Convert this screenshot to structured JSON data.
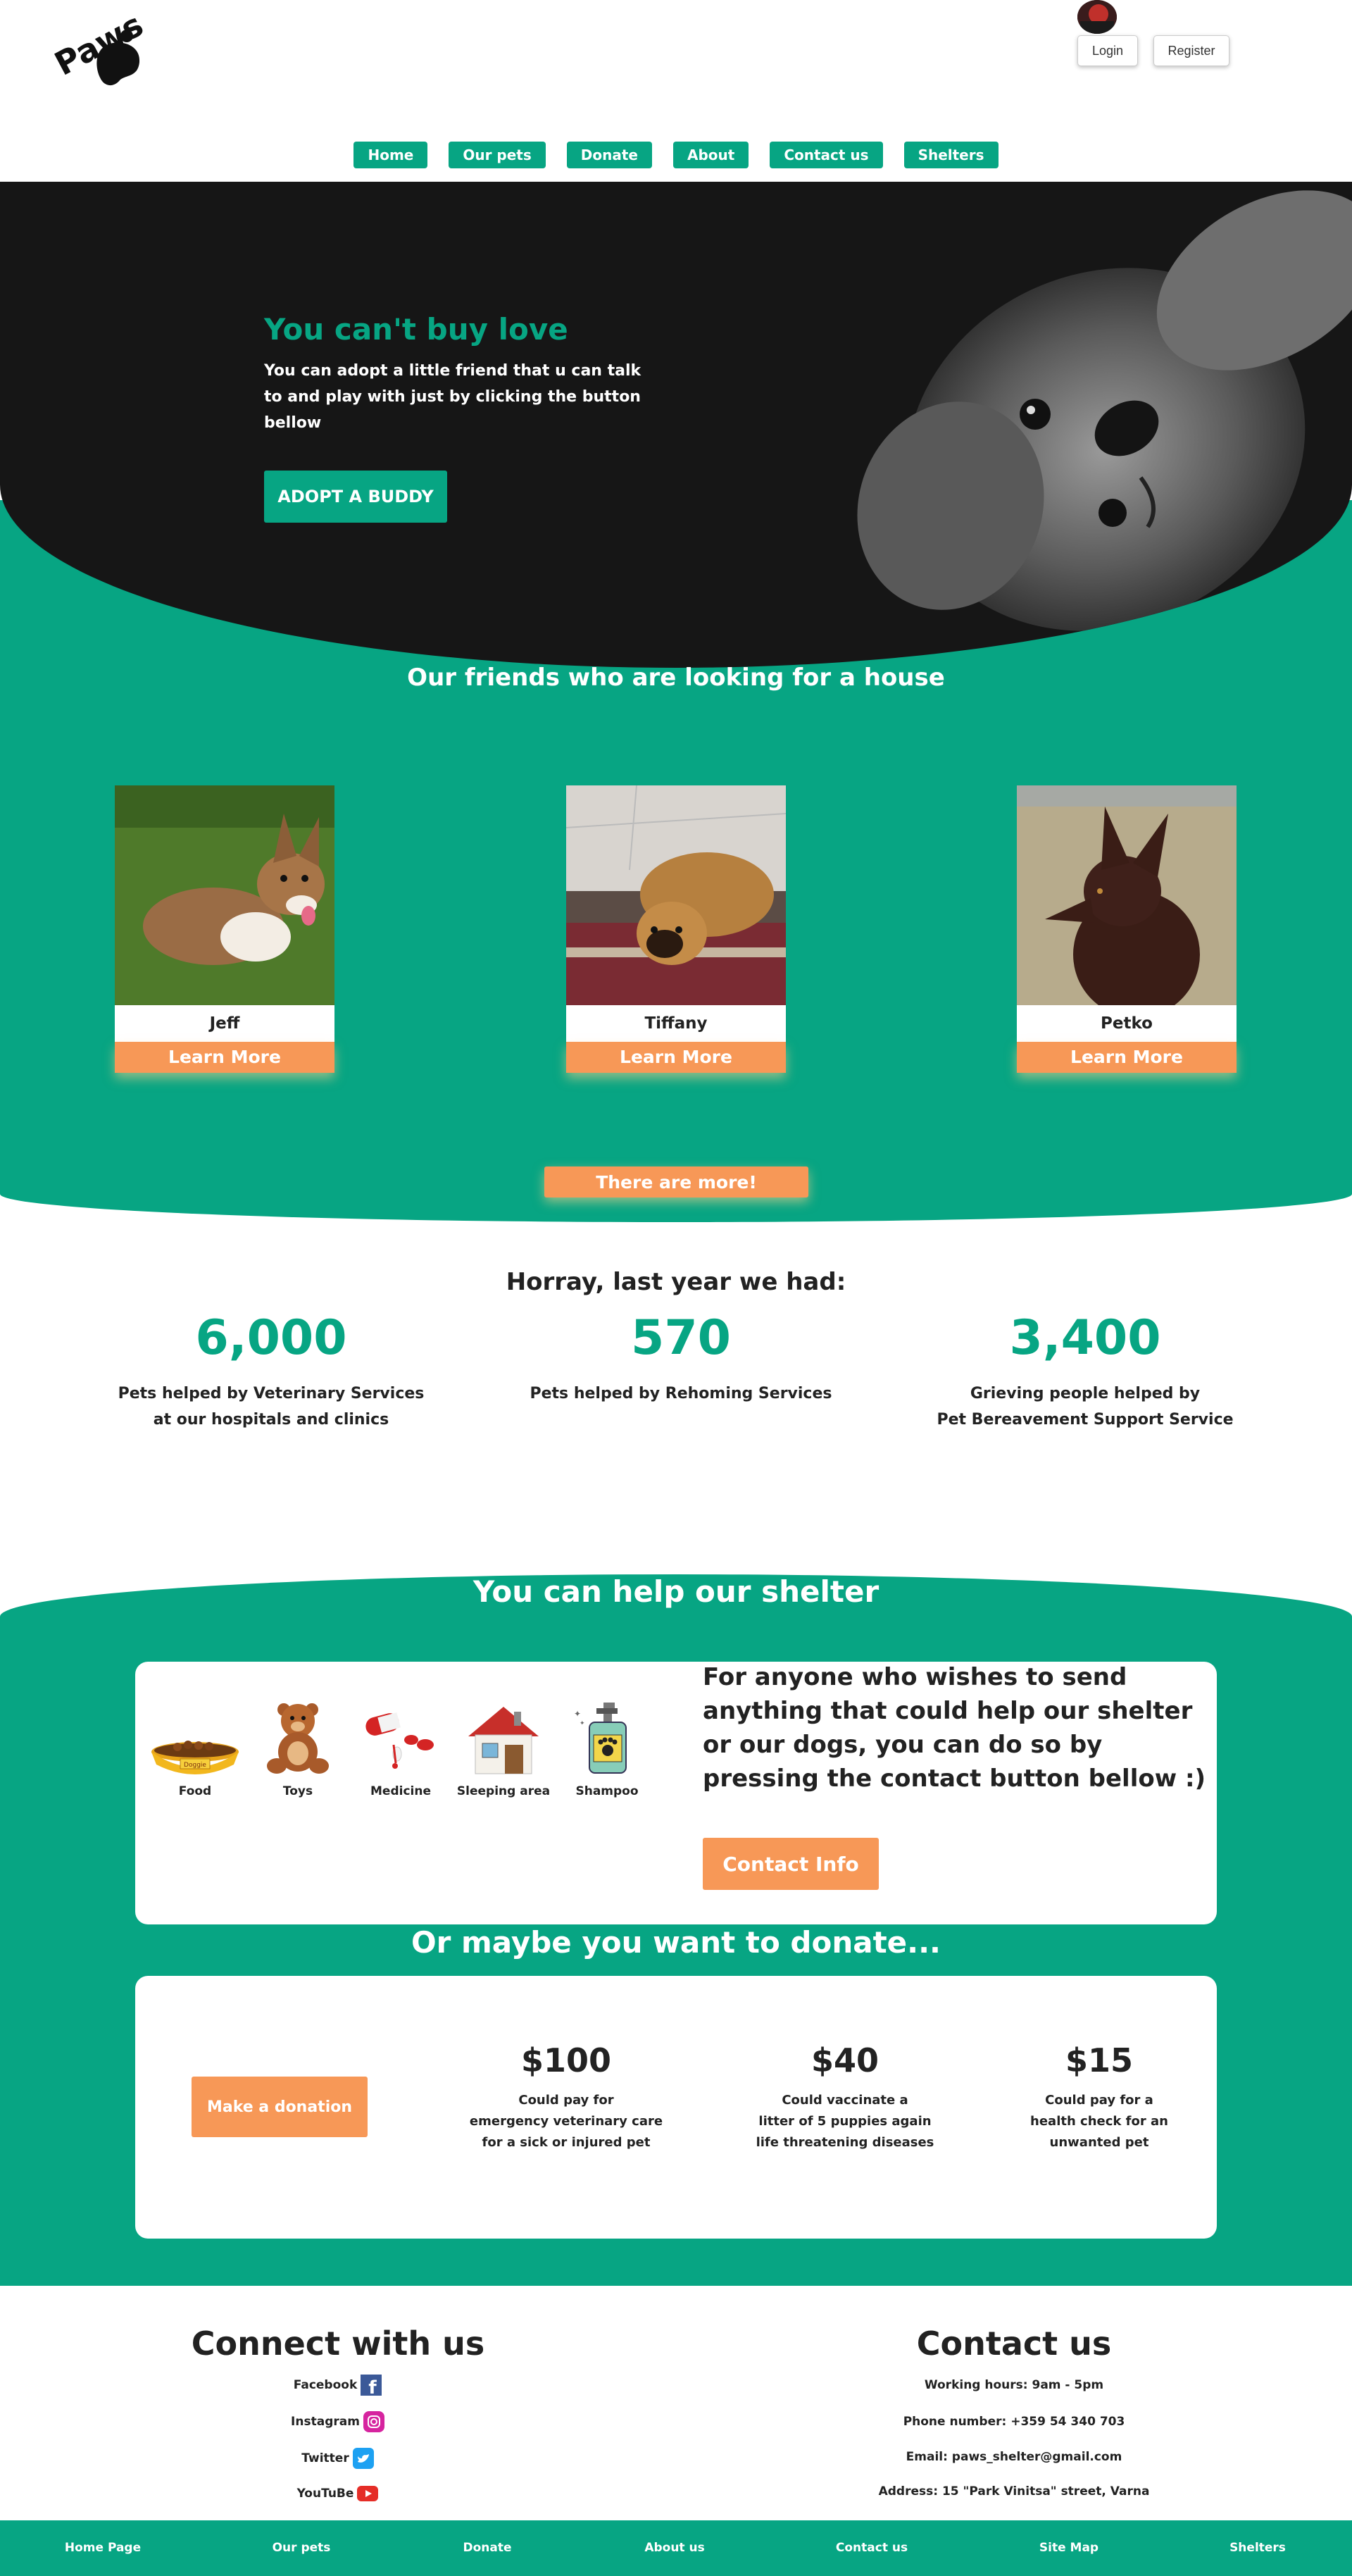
{
  "brand": {
    "logo_text": "Paws"
  },
  "header": {
    "login_label": "Login",
    "register_label": "Register"
  },
  "nav": {
    "items": [
      "Home",
      "Our pets",
      "Donate",
      "About",
      "Contact us",
      "Shelters"
    ]
  },
  "hero": {
    "title": "You can't buy love",
    "subtitle": "You can adopt a little friend that u can talk to and play with just by clicking the button bellow",
    "button": "ADOPT A BUDDY"
  },
  "friends": {
    "title": "Our friends who are looking for a house",
    "pets": [
      {
        "name": "Jeff",
        "button": "Learn More"
      },
      {
        "name": "Tiffany",
        "button": "Learn More"
      },
      {
        "name": "Petko",
        "button": "Learn More"
      }
    ],
    "more_button": "There are more!"
  },
  "stats": {
    "title": "Horray, last year we had:",
    "items": [
      {
        "value": "6,000",
        "line1": "Pets helped by Veterinary Services",
        "line2": "at our hospitals and clinics"
      },
      {
        "value": "570",
        "line1": "Pets helped by Rehoming Services",
        "line2": ""
      },
      {
        "value": "3,400",
        "line1": "Grieving people helped by",
        "line2": "Pet Bereavement Support Service"
      }
    ]
  },
  "help": {
    "title": "You can help our shelter",
    "items": [
      {
        "label": "Food",
        "icon": "food-bowl-icon",
        "sign": "Doggie"
      },
      {
        "label": "Toys",
        "icon": "teddy-bear-icon"
      },
      {
        "label": "Medicine",
        "icon": "medicine-icon"
      },
      {
        "label": "Sleeping area",
        "icon": "dog-house-icon"
      },
      {
        "label": "Shampoo",
        "icon": "shampoo-icon"
      }
    ],
    "text": "For anyone who wishes to send anything that could help our shelter or our dogs, you can do so by pressing the contact button bellow :)",
    "button": "Contact Info"
  },
  "donate": {
    "title": "Or maybe you want to donate...",
    "button": "Make a donation",
    "tiers": [
      {
        "amount": "$100",
        "l1": "Could pay for",
        "l2": "emergency veterinary care",
        "l3": "for a sick or injured pet"
      },
      {
        "amount": "$40",
        "l1": "Could vaccinate a",
        "l2": "litter of 5 puppies again",
        "l3": "life threatening diseases"
      },
      {
        "amount": "$15",
        "l1": "Could pay for a",
        "l2": "health check for an",
        "l3": "unwanted pet"
      }
    ]
  },
  "connect": {
    "title": "Connect with us",
    "links": [
      "Facebook",
      "Instagram",
      "Twitter",
      "YouTuBe"
    ]
  },
  "contact": {
    "title": "Contact us",
    "hours": "Working hours: 9am - 5pm",
    "phone": "Phone number: +359 54 340 703",
    "email": "Email: paws_shelter@gmail.com",
    "address": "Address: 15 \"Park Vinitsa\" street, Varna"
  },
  "footer": {
    "links": [
      "Home Page",
      "Our pets",
      "Donate",
      "About us",
      "Contact us",
      "Site Map",
      "Shelters"
    ]
  },
  "colors": {
    "primary": "#07a583",
    "accent": "#f79857",
    "hero_bg": "#161616"
  }
}
